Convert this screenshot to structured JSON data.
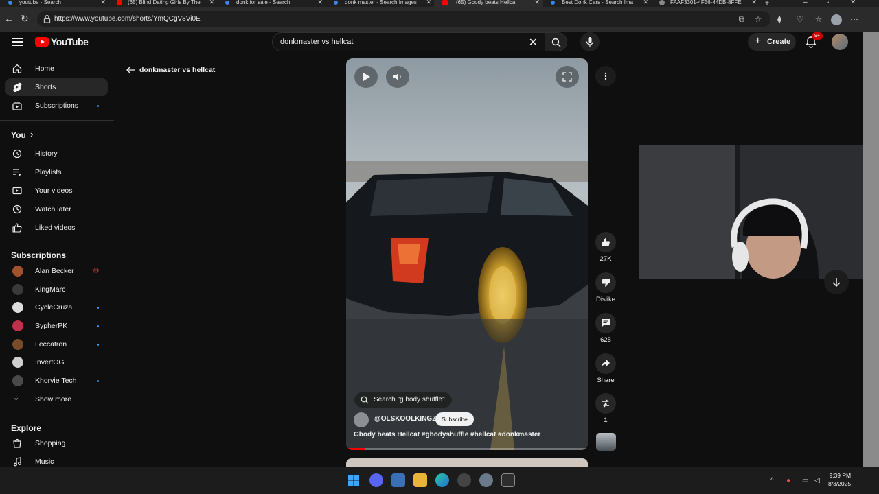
{
  "browser": {
    "tabs": [
      {
        "label": "youtube - Search",
        "active": false
      },
      {
        "label": "(65) Blind Dating Girls By The",
        "active": false
      },
      {
        "label": "donk for sale - Search",
        "active": false
      },
      {
        "label": "donk master - Search Images",
        "active": false
      },
      {
        "label": "(65) Gbody beats Hellca",
        "active": true
      },
      {
        "label": "Best Donk Cars - Search Ima",
        "active": false
      },
      {
        "label": "FAAF3301-4F56-44DB-8FFE",
        "active": false
      }
    ],
    "url": "https://www.youtube.com/shorts/YmQCgV8Vi0E"
  },
  "header": {
    "logo_text": "YouTube",
    "search_value": "donkmaster vs hellcat",
    "create_label": "Create",
    "notification_badge": "9+"
  },
  "sidebar": {
    "main": [
      {
        "label": "Home",
        "icon": "home-icon"
      },
      {
        "label": "Shorts",
        "icon": "shorts-icon",
        "active": true
      },
      {
        "label": "Subscriptions",
        "icon": "subscriptions-icon"
      }
    ],
    "you_heading": "You",
    "you_items": [
      {
        "label": "History",
        "icon": "history-icon"
      },
      {
        "label": "Playlists",
        "icon": "playlists-icon"
      },
      {
        "label": "Your videos",
        "icon": "your-videos-icon"
      },
      {
        "label": "Watch later",
        "icon": "watch-later-icon"
      },
      {
        "label": "Liked videos",
        "icon": "liked-videos-icon"
      }
    ],
    "subscriptions_heading": "Subscriptions",
    "subscriptions": [
      {
        "label": "Alan Becker",
        "status": "live",
        "color": "#a0522d"
      },
      {
        "label": "KingMarc",
        "status": "",
        "color": "#3a3a3a"
      },
      {
        "label": "CycleCruza",
        "status": "new",
        "color": "#dcdcdc"
      },
      {
        "label": "SypherPK",
        "status": "new",
        "color": "#c0304a"
      },
      {
        "label": "Leccatron",
        "status": "new",
        "color": "#7a4b2a"
      },
      {
        "label": "InvertOG",
        "status": "",
        "color": "#cfcfcf"
      },
      {
        "label": "Khorvie Tech",
        "status": "new",
        "color": "#4a4a4a"
      }
    ],
    "show_more": "Show more",
    "explore_heading": "Explore",
    "explore_items": [
      {
        "label": "Shopping",
        "icon": "shopping-icon"
      },
      {
        "label": "Music",
        "icon": "music-icon"
      }
    ]
  },
  "breadcrumb": {
    "label": "donkmaster vs hellcat"
  },
  "short": {
    "search_chip": "Search \"g body shuffle\"",
    "channel": "@OLSKOOLKINGZ",
    "subscribe_label": "Subscribe",
    "caption_plain": "Gbody beats Hellcat ",
    "caption_tags": "#gbodyshuffle #hellcat #donkmaster",
    "progress": 0.08
  },
  "actions": {
    "likes": "27K",
    "dislike_label": "Dislike",
    "comments": "625",
    "share_label": "Share",
    "remix_count": "1"
  },
  "taskbar": {
    "time": "9:39 PM",
    "date": "8/3/2025"
  },
  "colors": {
    "brand_red": "#ff0000",
    "background": "#0f0f0f",
    "accent_blue": "#3ea6ff"
  }
}
